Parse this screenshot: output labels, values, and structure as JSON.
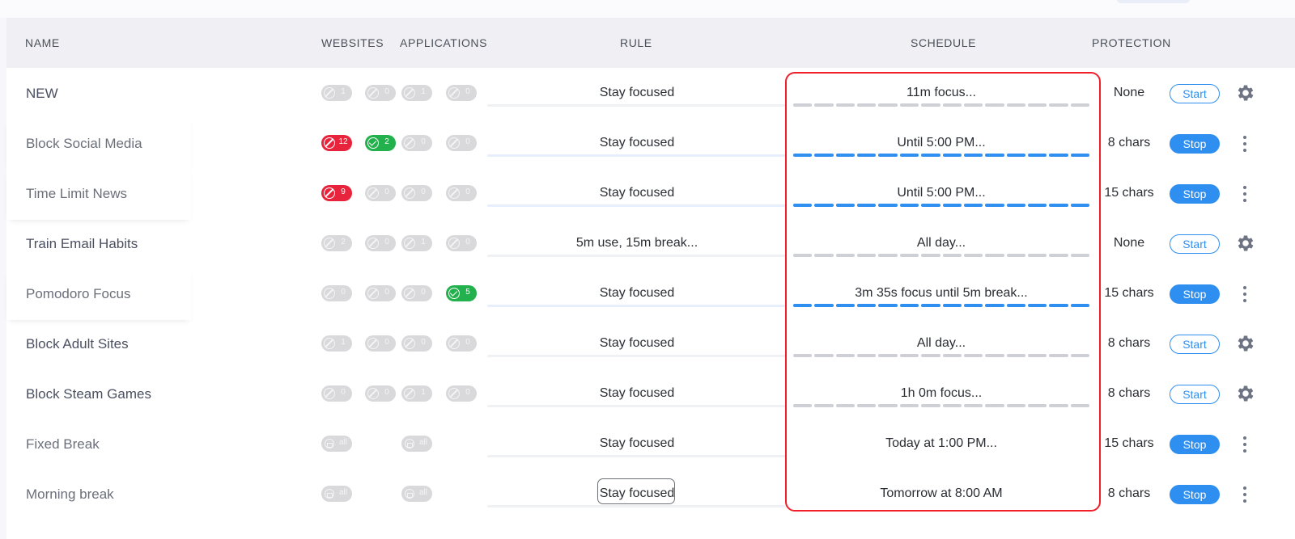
{
  "header": {
    "name": "NAME",
    "websites": "WEBSITES",
    "applications": "APPLICATIONS",
    "rule": "RULE",
    "schedule": "SCHEDULE",
    "protection": "PROTECTION"
  },
  "colors": {
    "accent": "#2e8ff0",
    "block_badge": "#e8243c",
    "allow_badge": "#22b14c",
    "highlight": "#f01f2a"
  },
  "rows": [
    {
      "name": "NEW",
      "websites_block": "1",
      "websites_allow": "0",
      "apps_block": "1",
      "apps_allow": "0",
      "rule": "Stay focused",
      "schedule": "11m focus...",
      "protection": "None",
      "action": "Start",
      "menu": "gear-icon"
    },
    {
      "name": "Block Social Media",
      "websites_block": "12",
      "websites_allow": "2",
      "apps_block": "0",
      "apps_allow": "0",
      "rule": "Stay focused",
      "schedule": "Until 5:00 PM...",
      "protection": "8 chars",
      "action": "Stop",
      "menu": "kebab-icon"
    },
    {
      "name": "Time Limit News",
      "websites_block": "9",
      "websites_allow": "0",
      "apps_block": "0",
      "apps_allow": "0",
      "rule": "Stay focused",
      "schedule": "Until 5:00 PM...",
      "protection": "15 chars",
      "action": "Stop",
      "menu": "kebab-icon"
    },
    {
      "name": "Train Email Habits",
      "websites_block": "2",
      "websites_allow": "0",
      "apps_block": "1",
      "apps_allow": "0",
      "rule": "5m use, 15m break...",
      "schedule": "All day...",
      "protection": "None",
      "action": "Start",
      "menu": "gear-icon"
    },
    {
      "name": "Pomodoro Focus",
      "websites_block": "0",
      "websites_allow": "0",
      "apps_block": "0",
      "apps_allow": "5",
      "rule": "Stay focused",
      "schedule": "3m 35s focus until 5m break...",
      "protection": "15 chars",
      "action": "Stop",
      "menu": "kebab-icon"
    },
    {
      "name": "Block Adult Sites",
      "websites_block": "1",
      "websites_allow": "0",
      "apps_block": "0",
      "apps_allow": "0",
      "rule": "Stay focused",
      "schedule": "All day...",
      "protection": "8 chars",
      "action": "Start",
      "menu": "gear-icon"
    },
    {
      "name": "Block Steam Games",
      "websites_block": "0",
      "websites_allow": "0",
      "apps_block": "1",
      "apps_allow": "0",
      "rule": "Stay focused",
      "schedule": "1h 0m focus...",
      "protection": "8 chars",
      "action": "Start",
      "menu": "gear-icon"
    },
    {
      "name": "Fixed Break",
      "websites_all": "all",
      "apps_all": "all",
      "rule": "Stay focused",
      "schedule": "Today at 1:00 PM...",
      "protection": "15 chars",
      "action": "Stop",
      "menu": "kebab-icon"
    },
    {
      "name": "Morning break",
      "websites_all": "all",
      "apps_all": "all",
      "rule": "Stay focused",
      "schedule": "Tomorrow at 8:00 AM",
      "protection": "8 chars",
      "action": "Stop",
      "menu": "kebab-icon"
    }
  ]
}
